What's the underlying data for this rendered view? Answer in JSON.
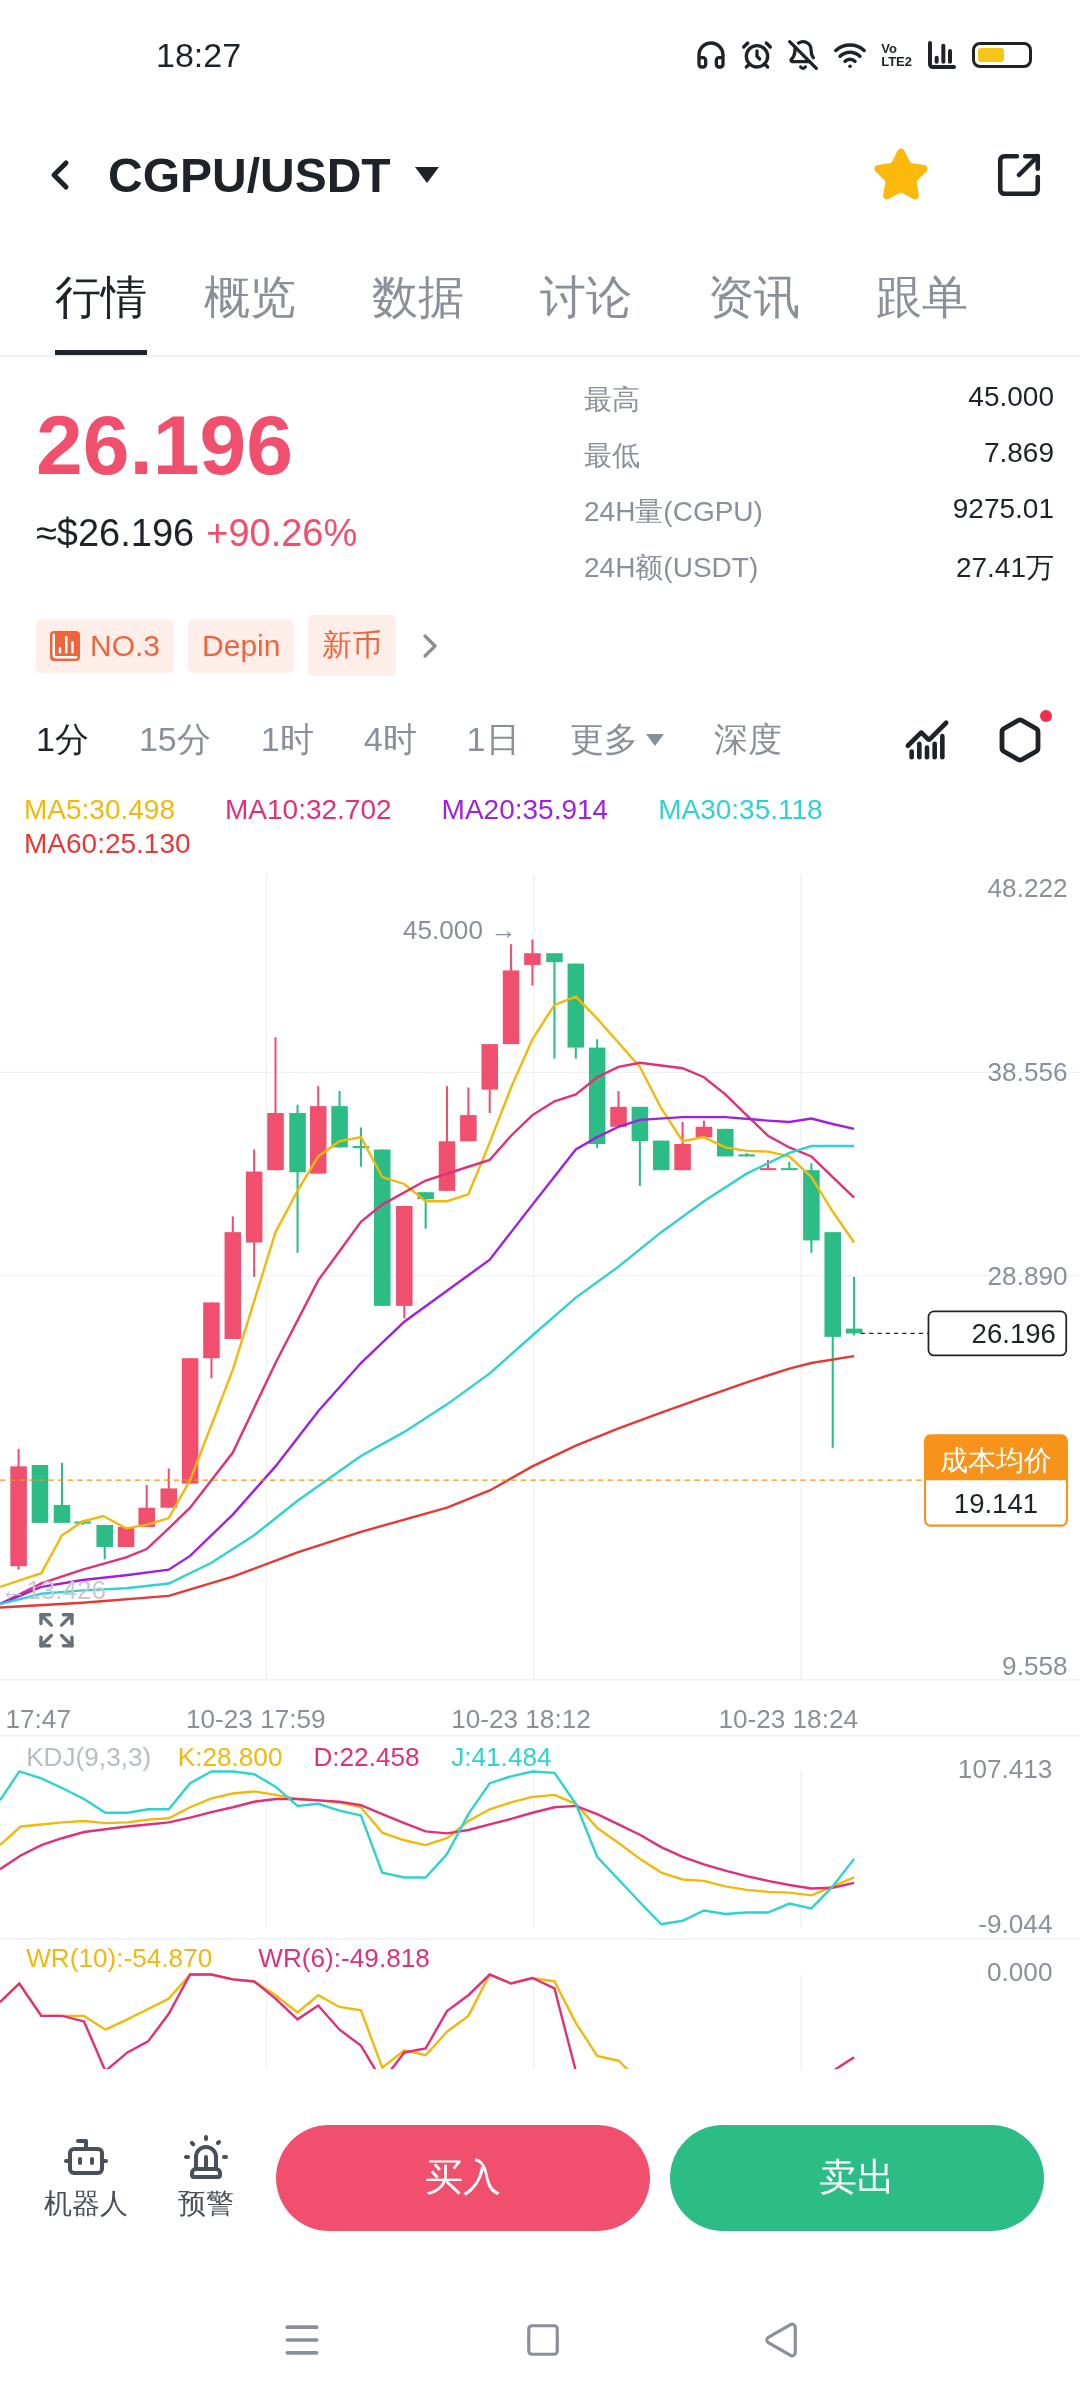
{
  "status_bar": {
    "time": "18:27",
    "volte": [
      "Vo",
      "LTE2"
    ]
  },
  "header": {
    "title": "CGPU/USDT",
    "favorite": true
  },
  "tabs": [
    {
      "label": "行情",
      "selected": true
    },
    {
      "label": "概览",
      "selected": false
    },
    {
      "label": "数据",
      "selected": false
    },
    {
      "label": "讨论",
      "selected": false
    },
    {
      "label": "资讯",
      "selected": false
    },
    {
      "label": "跟单",
      "selected": false
    }
  ],
  "price": {
    "last": "26.196",
    "usd": "≈$26.196",
    "change": "+90.26%"
  },
  "stats": [
    {
      "label": "最高",
      "value": "45.000"
    },
    {
      "label": "最低",
      "value": "7.869"
    },
    {
      "label": "24H量(CGPU)",
      "value": "9275.01"
    },
    {
      "label": "24H额(USDT)",
      "value": "27.41万"
    }
  ],
  "tags": [
    {
      "kind": "rank",
      "label": "NO.3"
    },
    {
      "kind": "plain",
      "label": "Depin"
    },
    {
      "kind": "plain",
      "label": "新币"
    }
  ],
  "periods": [
    {
      "label": "1分",
      "kind": "plain",
      "selected": true
    },
    {
      "label": "15分",
      "kind": "plain",
      "selected": false
    },
    {
      "label": "1时",
      "kind": "plain",
      "selected": false
    },
    {
      "label": "4时",
      "kind": "plain",
      "selected": false
    },
    {
      "label": "1日",
      "kind": "plain",
      "selected": false
    },
    {
      "label": "更多",
      "kind": "menu",
      "selected": false
    },
    {
      "label": "深度",
      "kind": "plain",
      "selected": false
    }
  ],
  "ma_legend": [
    {
      "label": "MA5:30.498",
      "color": "#f0b90b"
    },
    {
      "label": "MA10:32.702",
      "color": "#e0307a"
    },
    {
      "label": "MA20:35.914",
      "color": "#a020e0"
    },
    {
      "label": "MA30:35.118",
      "color": "#2ed3d0"
    },
    {
      "label": "MA60:25.130",
      "color": "#e53935"
    }
  ],
  "main_chart": {
    "y_labels": [
      "48.222",
      "38.556",
      "28.890",
      "9.558"
    ],
    "high_marker": "45.000 →",
    "low_marker": "←13.426",
    "last_price": "26.196",
    "cost_label": "成本均价",
    "cost_value": "19.141",
    "x_labels": [
      "17:47",
      "10-23 17:59",
      "10-23 18:12",
      "10-23 18:24"
    ]
  },
  "kdj": {
    "legend": [
      {
        "label": "KDJ(9,3,3)",
        "color": "#b7bdc6"
      },
      {
        "label": "K:28.800",
        "color": "#f0b90b"
      },
      {
        "label": "D:22.458",
        "color": "#e0307a"
      },
      {
        "label": "J:41.484",
        "color": "#2ed3d0"
      }
    ],
    "y_labels": [
      "107.413",
      "-9.044"
    ]
  },
  "wr": {
    "legend": [
      {
        "label": "WR(10):-54.870",
        "color": "#f0b90b"
      },
      {
        "label": "WR(6):-49.818",
        "color": "#e0307a"
      }
    ],
    "y_label": "0.000"
  },
  "bottom": {
    "tools": [
      {
        "kind": "robot",
        "label": "机器人"
      },
      {
        "kind": "alert",
        "label": "预警"
      }
    ],
    "buy": "买入",
    "sell": "卖出"
  }
}
